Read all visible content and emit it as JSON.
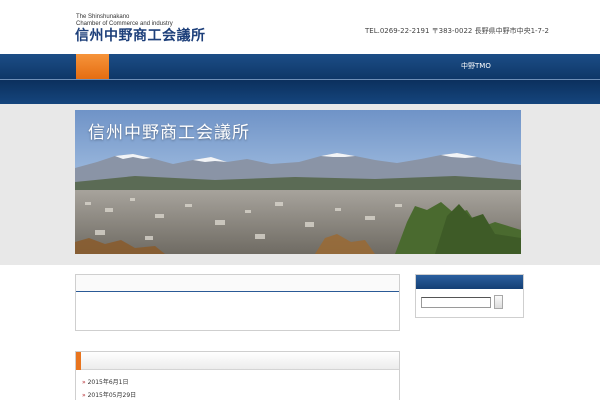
{
  "header": {
    "logo_en_line1": "The Shinshunakano",
    "logo_en_line2": "Chamber of Commerce and industry",
    "logo_ja": "信州中野商工会議所",
    "tagline": "",
    "contact": "TEL.0269-22-2191 〒383-0022 長野県中野市中央1-7-2"
  },
  "nav": {
    "row1": [
      "",
      "",
      "",
      "",
      "",
      "",
      "",
      "",
      "",
      "",
      "中野TMO"
    ],
    "row2": [
      "",
      ""
    ],
    "active_index": 0
  },
  "hero": {
    "title": "信州中野商工会議所"
  },
  "info": {
    "heading": "",
    "text": ""
  },
  "news": {
    "heading": "",
    "items": [
      {
        "marker": "»",
        "date": "2015年6月1日",
        "title": ""
      },
      {
        "marker": "»",
        "date": "2015年05月29日",
        "title": ""
      }
    ]
  },
  "sidebar": {
    "heading": "",
    "search_placeholder": ""
  },
  "colors": {
    "nav_blue": "#0e3768",
    "active_orange": "#e56d12",
    "logo_blue": "#1d3f7a",
    "link_blue": "#1d4f91"
  }
}
